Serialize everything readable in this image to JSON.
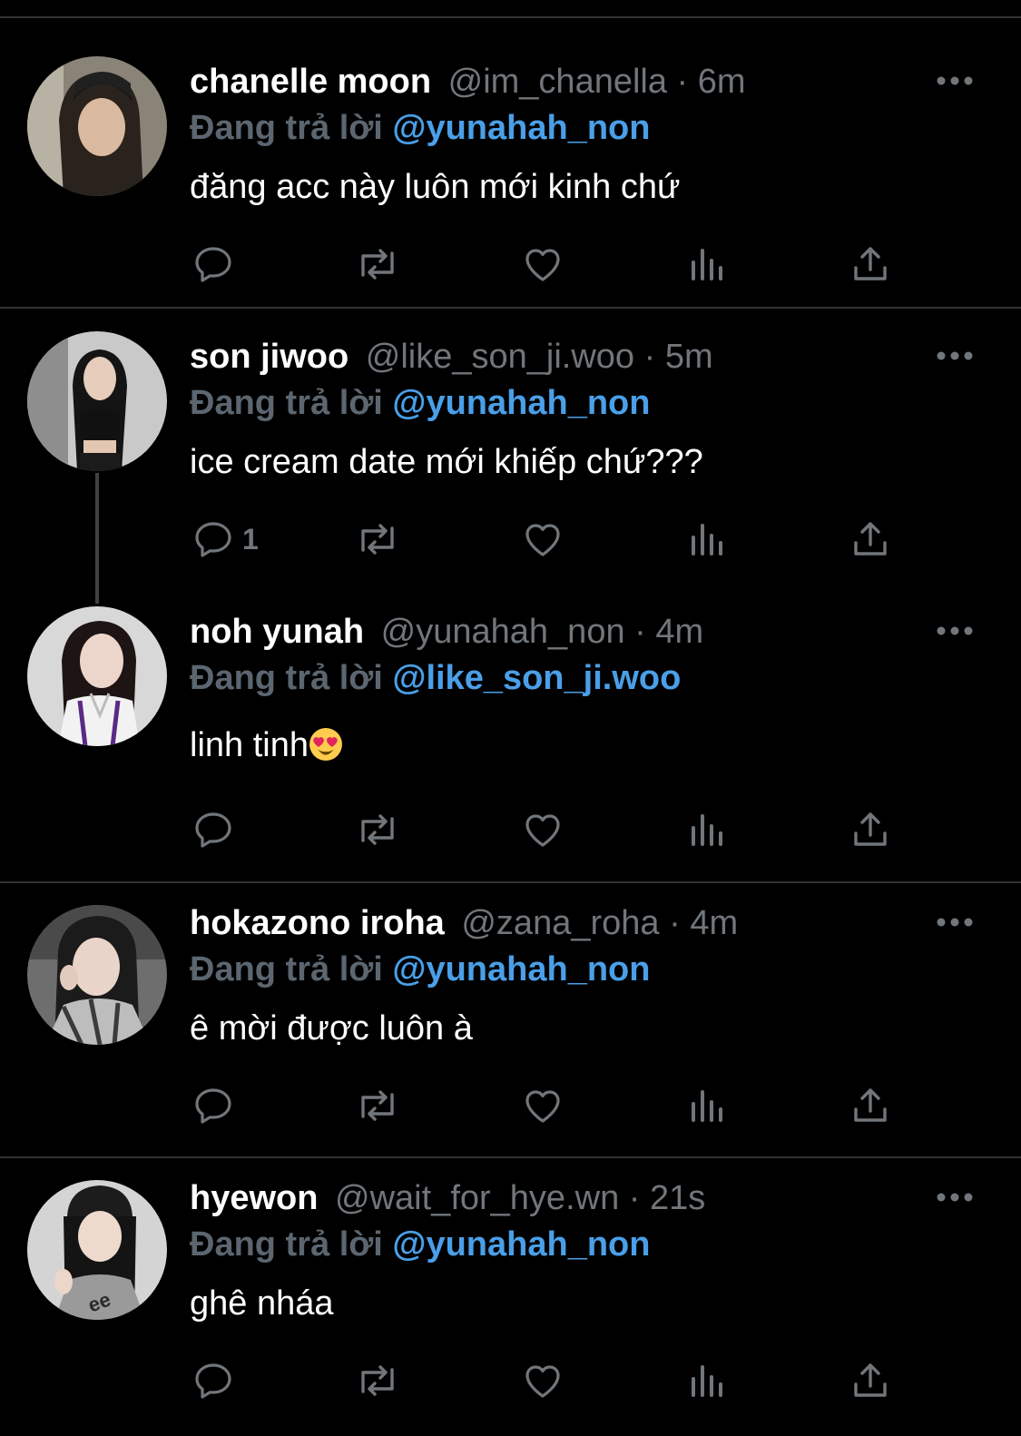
{
  "colors": {
    "background": "#000000",
    "divider": "#2f3336",
    "display_name": "#ffffff",
    "muted": "#71767b",
    "mention": "#4a9fe8",
    "icon": "#71767b"
  },
  "replies": [
    {
      "display_name": "chanelle moon",
      "handle": "@im_chanella",
      "separator": "·",
      "time": "6m",
      "reply_prefix": "Đang trả lời",
      "reply_to": "@yunahah_non",
      "text": "đăng acc này luôn mới kinh chứ",
      "reply_count": "",
      "icons": {
        "more": "more-horizontal-icon",
        "reply": "reply-icon",
        "retweet": "retweet-icon",
        "like": "heart-icon",
        "views": "analytics-icon",
        "share": "share-icon"
      }
    },
    {
      "display_name": "son jiwoo",
      "handle": "@like_son_ji.woo",
      "separator": "·",
      "time": "5m",
      "reply_prefix": "Đang trả lời",
      "reply_to": "@yunahah_non",
      "text": "ice cream date mới khiếp chứ???",
      "reply_count": "1",
      "icons": {
        "more": "more-horizontal-icon",
        "reply": "reply-icon",
        "retweet": "retweet-icon",
        "like": "heart-icon",
        "views": "analytics-icon",
        "share": "share-icon"
      }
    },
    {
      "display_name": "noh yunah",
      "handle": "@yunahah_non",
      "separator": "·",
      "time": "4m",
      "reply_prefix": "Đang trả lời",
      "reply_to": "@like_son_ji.woo",
      "text": "linh tinh",
      "text_emoji": "heart-eyes-emoji",
      "reply_count": "",
      "icons": {
        "more": "more-horizontal-icon",
        "reply": "reply-icon",
        "retweet": "retweet-icon",
        "like": "heart-icon",
        "views": "analytics-icon",
        "share": "share-icon"
      }
    },
    {
      "display_name": "hokazono iroha",
      "handle": "@zana_roha",
      "separator": "·",
      "time": "4m",
      "reply_prefix": "Đang trả lời",
      "reply_to": "@yunahah_non",
      "text": "ê mời được luôn à",
      "reply_count": "",
      "icons": {
        "more": "more-horizontal-icon",
        "reply": "reply-icon",
        "retweet": "retweet-icon",
        "like": "heart-icon",
        "views": "analytics-icon",
        "share": "share-icon"
      }
    },
    {
      "display_name": "hyewon",
      "handle": "@wait_for_hye.wn",
      "separator": "·",
      "time": "21s",
      "reply_prefix": "Đang trả lời",
      "reply_to": "@yunahah_non",
      "text": "ghê nháa",
      "reply_count": "",
      "icons": {
        "more": "more-horizontal-icon",
        "reply": "reply-icon",
        "retweet": "retweet-icon",
        "like": "heart-icon",
        "views": "analytics-icon",
        "share": "share-icon"
      }
    }
  ]
}
